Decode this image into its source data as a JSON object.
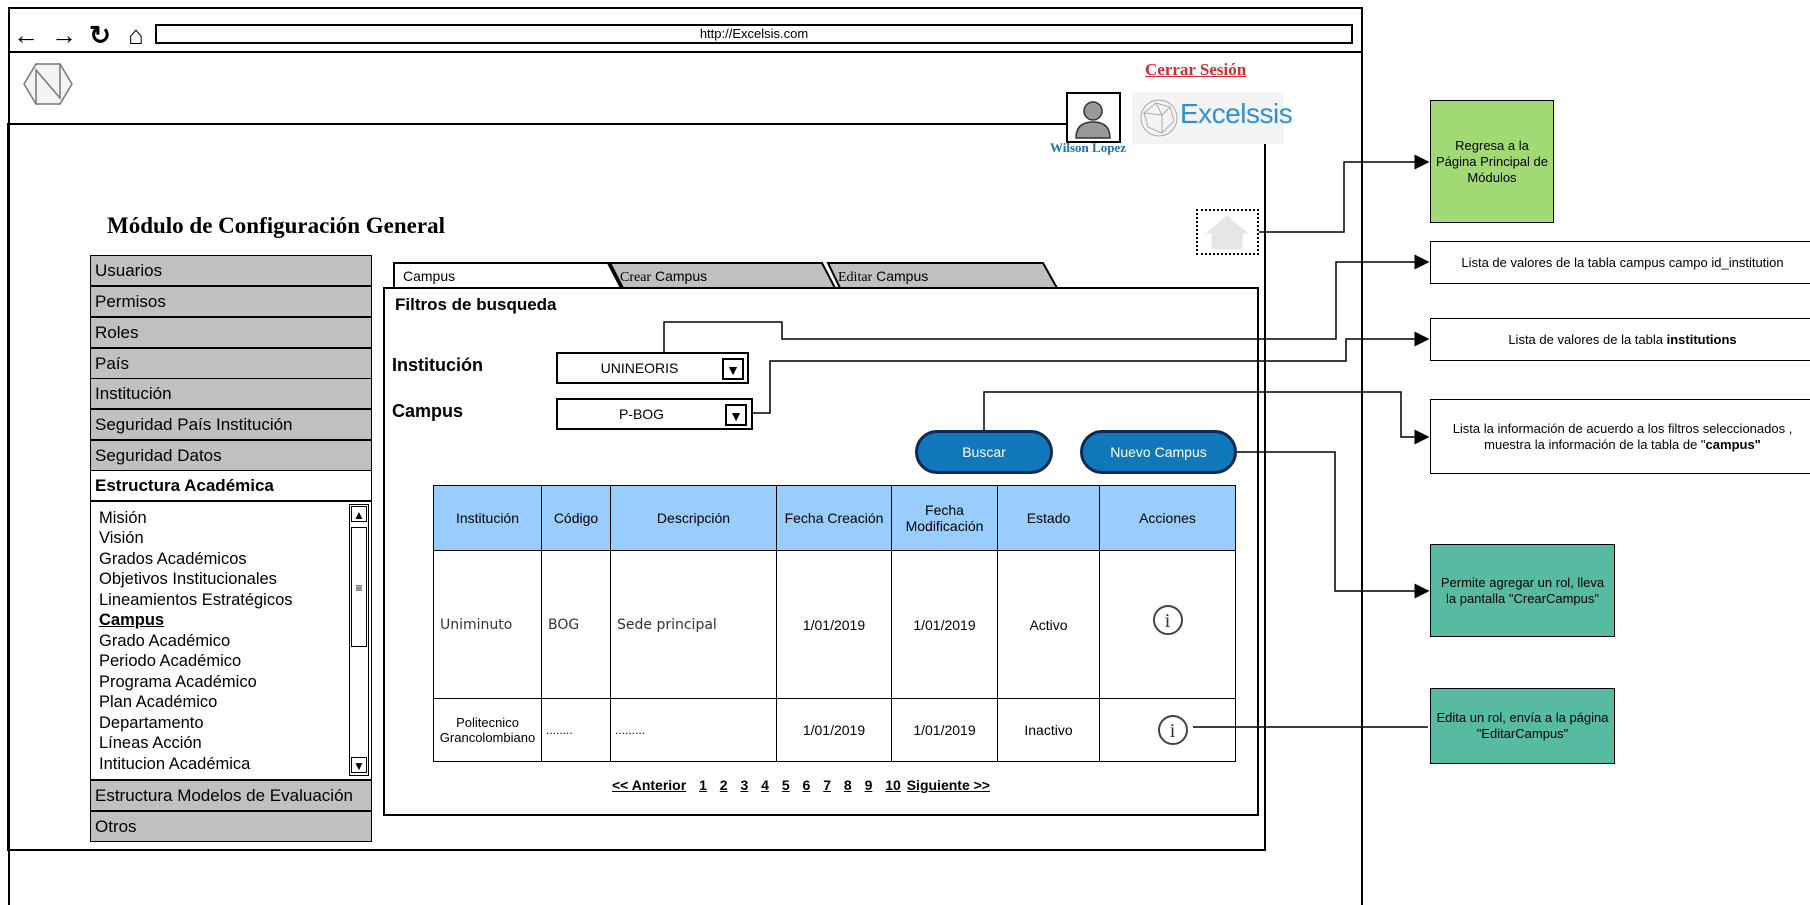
{
  "browser": {
    "url": "http://Excelsis.com",
    "nav_icons": [
      "back-arrow-icon",
      "forward-arrow-icon",
      "reload-icon",
      "home-icon"
    ]
  },
  "header": {
    "logout_label": "Cerrar Sesión",
    "user_name": "Wilson Lopez",
    "brand_name": "Excelssis"
  },
  "page": {
    "title": "Módulo de Configuración General"
  },
  "sidebar": {
    "items": [
      {
        "label": "Usuarios"
      },
      {
        "label": "Permisos"
      },
      {
        "label": "Roles"
      },
      {
        "label": "País"
      },
      {
        "label": "Institución"
      },
      {
        "label": "Seguridad País Institución"
      },
      {
        "label": "Seguridad Datos"
      },
      {
        "label": "Estructura Académica"
      }
    ],
    "submenu": [
      "Misión",
      "Visión",
      "Grados Académicos",
      "Objetivos Institucionales",
      "Lineamientos Estratégicos",
      "Campus",
      "Grado Académico",
      "Periodo Académico",
      "Programa Académico",
      "Plan Académico",
      "Departamento",
      "Líneas Acción",
      "Intitucion Académica"
    ],
    "submenu_selected": "Campus",
    "bottom_items": [
      {
        "label": "Estructura Modelos de Evaluación"
      },
      {
        "label": "Otros"
      }
    ]
  },
  "tabs": [
    {
      "prefix": "",
      "label": "Campus"
    },
    {
      "prefix": "Crear",
      "label": "Campus"
    },
    {
      "prefix": "Editar",
      "label": "Campus"
    }
  ],
  "filters": {
    "title": "Filtros de busqueda",
    "institution_label": "Institución",
    "institution_value": "UNINEORIS",
    "campus_label": "Campus",
    "campus_value": "P-BOG",
    "search_button": "Buscar",
    "new_button": "Nuevo Campus"
  },
  "table": {
    "headers": [
      "Institución",
      "Código",
      "Descripción",
      "Fecha Creación",
      "Fecha Modificación",
      "Estado",
      "Acciones"
    ],
    "rows": [
      {
        "institution": "Uniminuto",
        "code": "BOG",
        "description": "Sede principal",
        "created": "1/01/2019",
        "modified": "1/01/2019",
        "status": "Activo"
      },
      {
        "institution": "Politecnico Grancolombiano",
        "code": "........",
        "description": ".........",
        "created": "1/01/2019",
        "modified": "1/01/2019",
        "status": "Inactivo"
      }
    ]
  },
  "pagination": {
    "prev": "<< Anterior",
    "pages": [
      "1",
      "2",
      "3",
      "4",
      "5",
      "6",
      "7",
      "8",
      "9",
      "10"
    ],
    "next": "Siguiente >>"
  },
  "annotations": {
    "home": "Regresa a la Página Principal de Módulos",
    "campus_list": "Lista de valores de la tabla campus campo  id_institution",
    "institutions_prefix": "Lista de valores de la tabla ",
    "institutions_bold": "institutions",
    "search_prefix": "Lista la información de acuerdo a los filtros seleccionados , muestra la información de la tabla de \"",
    "search_bold": "campus\"",
    "create": "Permite agregar un rol, lleva la pantalla \"CrearCampus\"",
    "edit": "Edita un rol, envía  a la página \"EditarCampus\""
  },
  "colors": {
    "menu_gray": "#c0c0c0",
    "header_blue": "#99ccff",
    "button_blue": "#1177bb",
    "note_green": "#a1d975",
    "note_teal": "#56bba1",
    "logout_red": "#cc2e3a"
  }
}
